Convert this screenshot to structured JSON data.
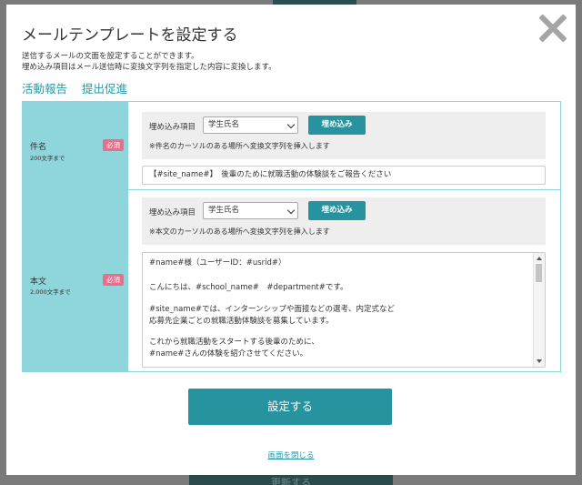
{
  "background": {
    "bottom_button_label": "更新する"
  },
  "modal": {
    "title": "メールテンプレートを設定する",
    "description_line1": "送信するメールの文面を設定することができます。",
    "description_line2": "埋め込み項目はメール送信時に変換文字列を指定した内容に変換します。",
    "tabs": [
      "活動報告",
      "提出促進"
    ],
    "subject": {
      "label": "件名",
      "limit": "200文字まで",
      "required_badge": "必須",
      "embed_label": "埋め込み項目",
      "embed_selected": "学生氏名",
      "embed_button": "埋め込み",
      "embed_note": "※件名のカーソルのある場所へ変換文字列を挿入します",
      "value": "【#site_name#】　後輩のために就職活動の体験談をご報告ください"
    },
    "body": {
      "label": "本文",
      "limit": "2,000文字まで",
      "required_badge": "必須",
      "embed_label": "埋め込み項目",
      "embed_selected": "学生氏名",
      "embed_button": "埋め込み",
      "embed_note": "※本文のカーソルのある場所へ変換文字列を挿入します",
      "lines": [
        "#name#様（ユーザーID：#usrid#）",
        "こんにちは、#school_name#　#department#です。",
        "#site_name#では、インターンシップや面接などの選考、内定式など",
        "応募先企業ごとの就職活動体験談を募集しています。",
        "これから就職活動をスタートする後輩のために、",
        "#name#さんの体験を紹介させてください。"
      ]
    },
    "submit_label": "設定する",
    "close_link": "画面を閉じる"
  },
  "colors": {
    "accent": "#26939e",
    "label_bg": "#8fd5dc",
    "required": "#ee6b8a"
  }
}
